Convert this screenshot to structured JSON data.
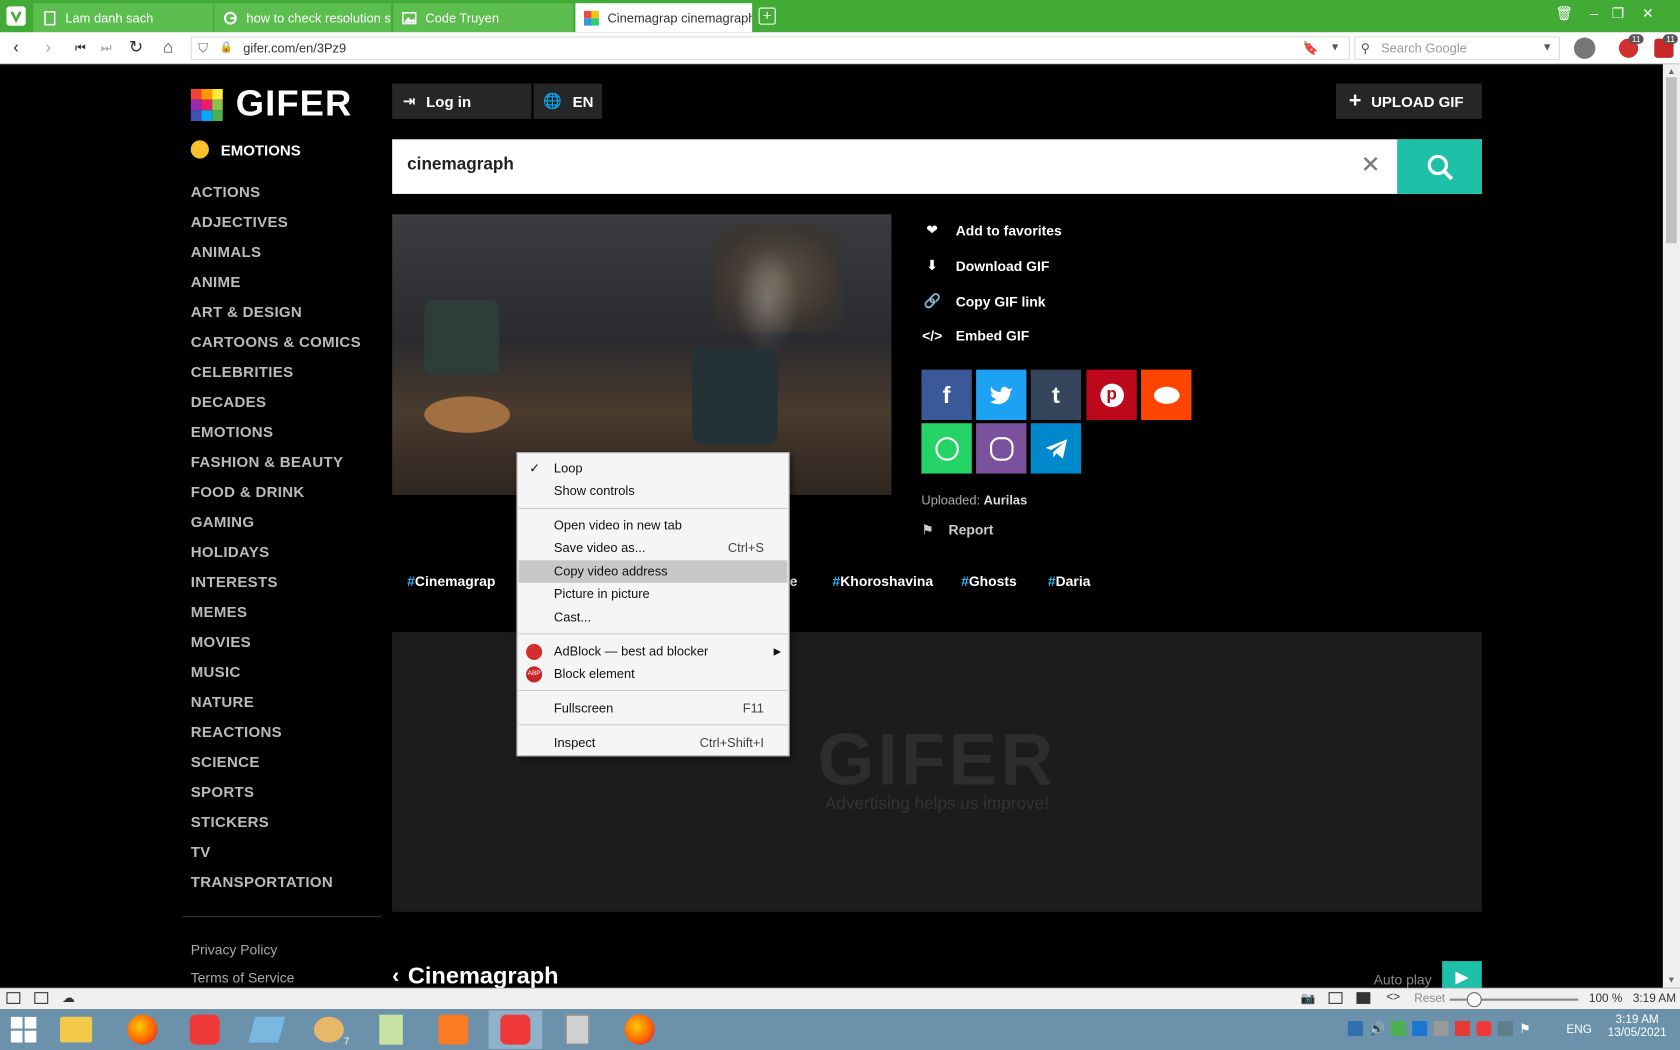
{
  "browser": {
    "tabs": [
      {
        "title": "Lam danh sach"
      },
      {
        "title": "how to check resolution siz"
      },
      {
        "title": "Code Truyen"
      },
      {
        "title": "Cinemagrap cinemagraph |"
      }
    ],
    "url": "gifer.com/en/3Pz9",
    "search_placeholder": "Search Google",
    "badge_count": "11",
    "badge_count2": "11"
  },
  "site": {
    "logo": "GIFER",
    "login_label": "Log in",
    "lang_label": "EN",
    "upload_label": "UPLOAD GIF",
    "emotions_header": "EMOTIONS",
    "categories": [
      "ACTIONS",
      "ADJECTIVES",
      "ANIMALS",
      "ANIME",
      "ART & DESIGN",
      "CARTOONS & COMICS",
      "CELEBRITIES",
      "DECADES",
      "EMOTIONS",
      "FASHION & BEAUTY",
      "FOOD & DRINK",
      "GAMING",
      "HOLIDAYS",
      "INTERESTS",
      "MEMES",
      "MOVIES",
      "MUSIC",
      "NATURE",
      "REACTIONS",
      "SCIENCE",
      "SPORTS",
      "STICKERS",
      "TV",
      "TRANSPORTATION"
    ],
    "footer_links": [
      "Privacy Policy",
      "Terms of Service"
    ],
    "search_value": "cinemagraph",
    "actions": [
      "Add to favorites",
      "Download GIF",
      "Copy GIF link",
      "Embed GIF"
    ],
    "uploaded_label": "Uploaded:",
    "uploader": "Aurilas",
    "report_label": "Report",
    "tags": [
      "Cinemagrap",
      "e",
      "Khoroshavina",
      "Ghosts",
      "Daria"
    ],
    "ad_logo": "GIFER",
    "ad_text": "Advertising helps us improve!",
    "section_title": "Cinemagraph",
    "autoplay_label": "Auto play"
  },
  "context_menu": {
    "items": [
      {
        "label": "Loop",
        "shortcut": ""
      },
      {
        "label": "Show controls",
        "shortcut": ""
      },
      {
        "label": "Open video in new tab",
        "shortcut": ""
      },
      {
        "label": "Save video as...",
        "shortcut": "Ctrl+S"
      },
      {
        "label": "Copy video address",
        "shortcut": ""
      },
      {
        "label": "Picture in picture",
        "shortcut": ""
      },
      {
        "label": "Cast...",
        "shortcut": ""
      },
      {
        "label": "AdBlock — best ad blocker",
        "shortcut": ""
      },
      {
        "label": "Block element",
        "shortcut": ""
      },
      {
        "label": "Fullscreen",
        "shortcut": "F11"
      },
      {
        "label": "Inspect",
        "shortcut": "Ctrl+Shift+I"
      }
    ]
  },
  "statusbar": {
    "reset_label": "Reset",
    "zoom": "100 %",
    "time": "3:19 AM"
  },
  "taskbar": {
    "lang": "ENG",
    "time": "3:19 AM",
    "date": "13/05/2021",
    "paint_badge": "7"
  },
  "colors": {
    "tabbar": "#41ab35",
    "search_button": "#1fc0a8",
    "facebook": "#3b5998",
    "twitter": "#1da1f2",
    "tumblr": "#35465c",
    "pinterest": "#bd081c",
    "reddit": "#ff4500",
    "whatsapp": "#25d366",
    "viber": "#7b519d",
    "telegram": "#0088cc"
  }
}
